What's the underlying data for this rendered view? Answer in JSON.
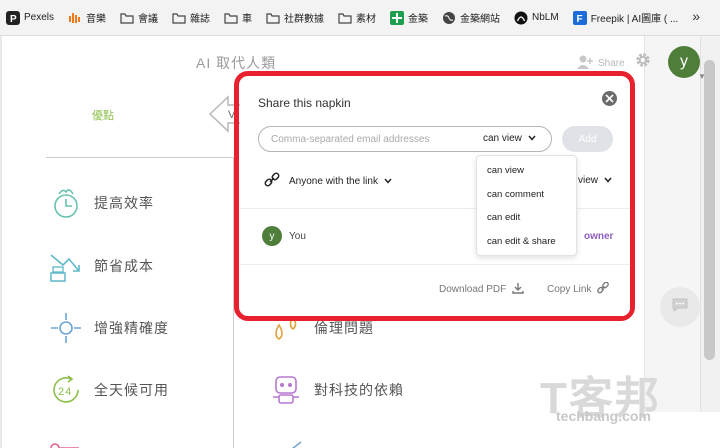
{
  "bookmarks": {
    "items": [
      {
        "label": "Pexels",
        "icon": "pexels-icon"
      },
      {
        "label": "音樂",
        "icon": "music-icon"
      },
      {
        "label": "會議",
        "icon": "folder-icon"
      },
      {
        "label": "雜誌",
        "icon": "folder-icon"
      },
      {
        "label": "車",
        "icon": "folder-icon"
      },
      {
        "label": "社群數據",
        "icon": "folder-icon"
      },
      {
        "label": "素材",
        "icon": "folder-icon"
      },
      {
        "label": "金築",
        "icon": "sheets-icon"
      },
      {
        "label": "金築網站",
        "icon": "globe-icon"
      },
      {
        "label": "NbLM",
        "icon": "notebooklm-icon"
      },
      {
        "label": "Freepik | AI圖庫 ( ...",
        "icon": "freepik-icon"
      }
    ],
    "more": "»"
  },
  "header": {
    "title": "AI 取代人類",
    "share_label": "Share",
    "avatar_letter": "y"
  },
  "diagram": {
    "column_header": "優點",
    "arrow_letter": "V",
    "items": [
      {
        "label": "提高效率",
        "icon": "clock-flame-icon"
      },
      {
        "label": "節省成本",
        "icon": "money-down-icon"
      },
      {
        "label": "增強精確度",
        "icon": "target-icon"
      },
      {
        "label": "全天候可用",
        "icon": "24h-icon"
      }
    ],
    "right_items": [
      {
        "label": "倫理問題",
        "icon": "droplets-icon"
      },
      {
        "label": "對科技的依賴",
        "icon": "robot-icon"
      }
    ]
  },
  "modal": {
    "title": "Share this napkin",
    "email_placeholder": "Comma-separated email addresses",
    "permission": "can view",
    "add_label": "Add",
    "link_label": "Anyone with the link",
    "link_permission": "view",
    "dropdown_options": [
      "can view",
      "can comment",
      "can edit",
      "can edit & share"
    ],
    "user": {
      "avatar": "y",
      "name": "You",
      "role": "owner"
    },
    "download_label": "Download PDF",
    "copy_label": "Copy Link"
  },
  "watermark": {
    "logo": "T客邦",
    "url": "techbang.com"
  },
  "colors": {
    "highlight": "#e8212e",
    "owner": "#8f5fbf",
    "avatar": "#4f7d3a",
    "column_header": "#8bbf4a"
  }
}
